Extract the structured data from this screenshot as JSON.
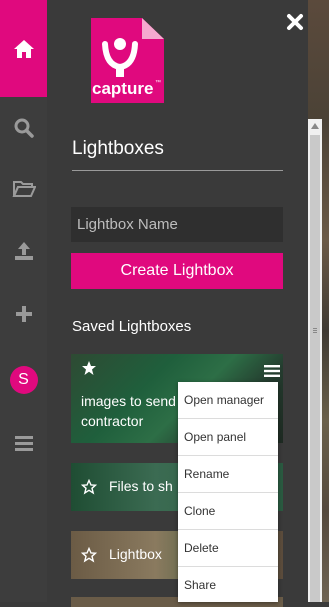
{
  "nav": {
    "avatar_initial": "S",
    "icons": [
      "home-icon",
      "search-icon",
      "folder-open-icon",
      "upload-icon",
      "plus-icon",
      "avatar",
      "hamburger-menu-icon"
    ]
  },
  "brand": {
    "logo_text": "capture",
    "trademark": "™"
  },
  "panel": {
    "title": "Lightboxes",
    "name_input": {
      "placeholder": "Lightbox Name",
      "value": ""
    },
    "create_button": "Create Lightbox",
    "saved_title": "Saved Lightboxes",
    "lightboxes": [
      {
        "label": "images to send to contractor",
        "visible_label": "images to send\ncontractor",
        "starred": true
      },
      {
        "label": "Files to sh",
        "starred": false
      },
      {
        "label": "Lightbox",
        "starred": false
      }
    ]
  },
  "context_menu": {
    "items": [
      "Open manager",
      "Open panel",
      "Rename",
      "Clone",
      "Delete",
      "Share"
    ]
  },
  "colors": {
    "accent": "#e0097e",
    "rail": "#3d3d3d",
    "panel": "#3a3a3a"
  }
}
